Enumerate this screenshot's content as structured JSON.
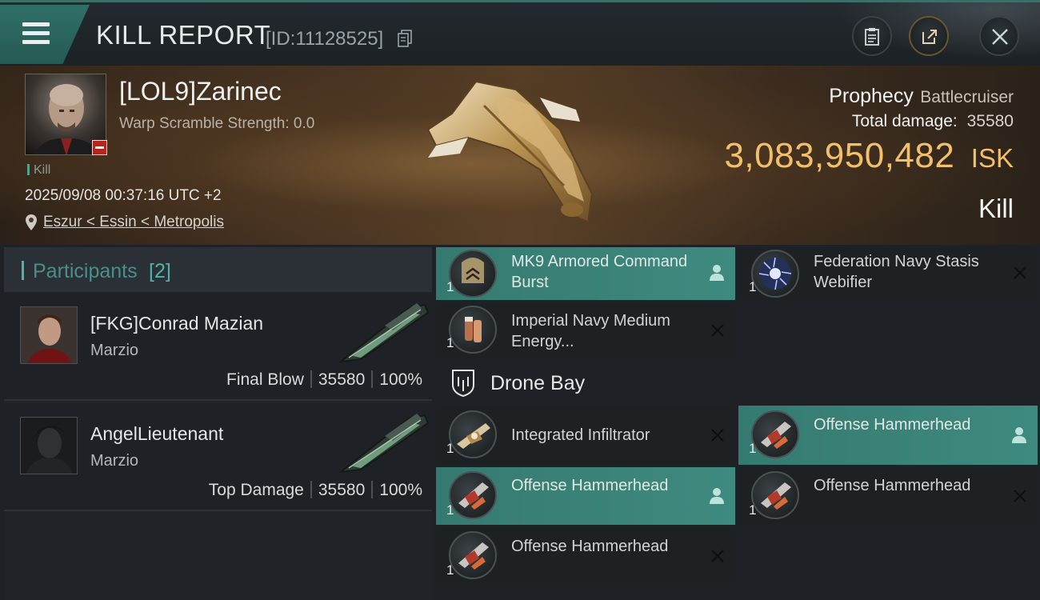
{
  "header": {
    "title": "KILL REPORT",
    "report_id": "[ID:11128525]",
    "icons": [
      "menu-icon",
      "copy-icon",
      "clipboard-icon",
      "share-icon",
      "close-icon"
    ]
  },
  "victim": {
    "name": "[LOL9]Zarinec",
    "warp_scramble": "Warp Scramble Strength: 0.0",
    "kill_tag": "Kill",
    "datetime": "2025/09/08 00:37:16 UTC +2",
    "location": "Eszur < Essin < Metropolis",
    "ship_name": "Prophecy",
    "ship_class": "Battlecruiser",
    "total_damage_label": "Total damage:",
    "total_damage": "35580",
    "isk_value": "3,083,950,482",
    "isk_unit": "ISK",
    "result": "Kill"
  },
  "participants": {
    "title": "Participants",
    "count": "[2]",
    "rows": [
      {
        "name": "[FKG]Conrad Mazian",
        "ship": "Marzio",
        "role": "Final Blow",
        "damage": "35580",
        "percent": "100%"
      },
      {
        "name": "AngelLieutenant",
        "ship": "Marzio",
        "role": "Top Damage",
        "damage": "35580",
        "percent": "100%"
      }
    ]
  },
  "modules": [
    {
      "name": "MK9 Armored Command Burst",
      "qty": "1",
      "highlighted": true,
      "status": "dropped"
    },
    {
      "name": "Federation Navy Stasis Webifier",
      "qty": "1",
      "highlighted": false,
      "status": "destroyed"
    },
    {
      "name": "Imperial Navy Medium Energy...",
      "qty": "1",
      "highlighted": false,
      "status": "destroyed"
    }
  ],
  "drone_bay": {
    "title": "Drone Bay",
    "items": [
      {
        "name": "Integrated Infiltrator",
        "qty": "1",
        "highlighted": false,
        "status": "destroyed"
      },
      {
        "name": "Offense Hammerhead",
        "qty": "1",
        "highlighted": true,
        "status": "dropped"
      },
      {
        "name": "Offense Hammerhead",
        "qty": "1",
        "highlighted": true,
        "status": "dropped"
      },
      {
        "name": "Offense Hammerhead",
        "qty": "1",
        "highlighted": false,
        "status": "destroyed"
      },
      {
        "name": "Offense Hammerhead",
        "qty": "1",
        "highlighted": false,
        "status": "destroyed"
      }
    ]
  },
  "colors": {
    "accent_teal": "#3f8a80",
    "isk_gold": "#f2c06a",
    "participants_title": "#4b8f89"
  }
}
